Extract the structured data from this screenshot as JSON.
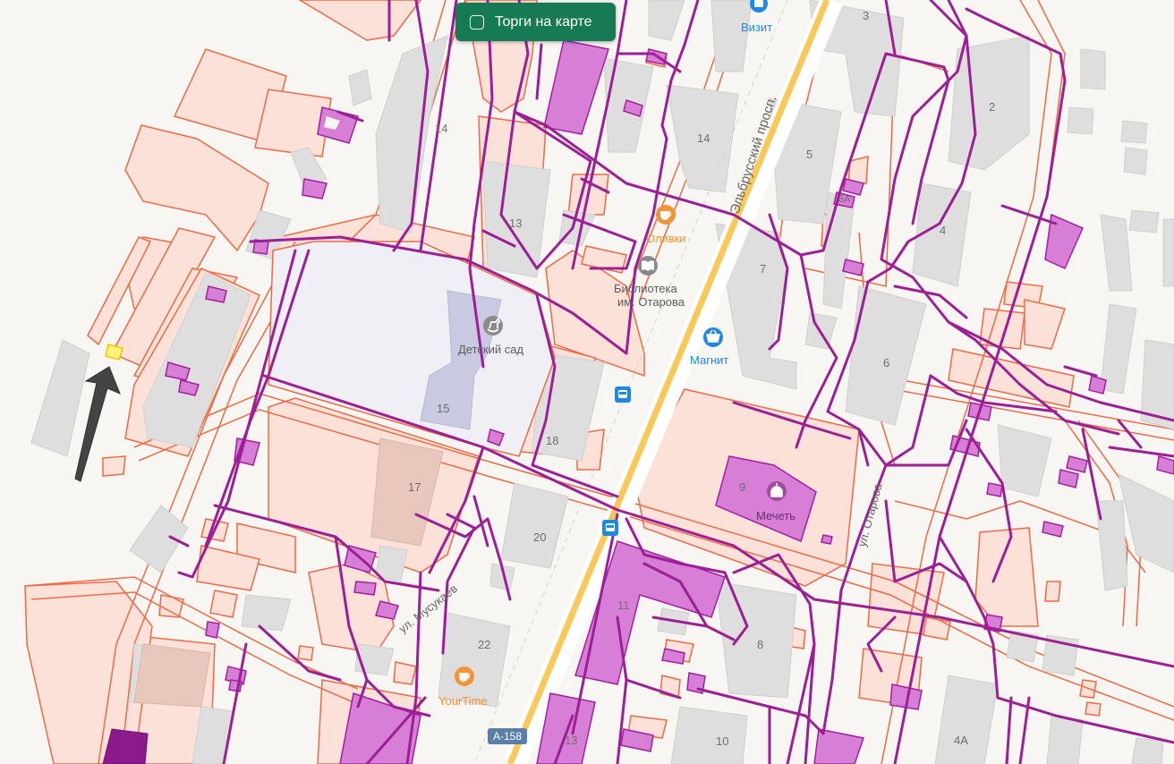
{
  "toggle": {
    "label": "Торги на карте",
    "checked": false
  },
  "pois": {
    "vizit": "Визит",
    "olivki": "Оливки",
    "library_line1": "Библиотека",
    "library_line2": "им. Отарова",
    "kindergarten": "Детский сад",
    "magnit": "Магнит",
    "mosque": "Мечеть",
    "yourtime": "YourTime"
  },
  "streets": {
    "elbrus": "Эльбрусский просп.",
    "otarova": "ул. Отарова",
    "musukaev": "ул. Мусукаев"
  },
  "road_badge": "А-158",
  "house_numbers": {
    "h3": "3",
    "h2": "2",
    "h14a": "14",
    "h14b": "14",
    "h5": "5",
    "h5a": "5А",
    "h4": "4",
    "h13": "13",
    "h7": "7",
    "h6": "6",
    "h15": "15",
    "h18": "18",
    "h9": "9",
    "h17": "17",
    "h20": "20",
    "h11": "11",
    "h8": "8",
    "h22": "22",
    "h13b": "13",
    "h10": "10",
    "h4a": "4А"
  },
  "colors": {
    "parcel_fill": "#fbe1d8",
    "parcel_stroke": "#ee6a45",
    "building": "#dedede",
    "magenta": "#9d1f95",
    "highlight": "#fff37a",
    "main_road": "#f8c95a"
  },
  "icons": {
    "shop": "shopping-bag-icon",
    "cafe": "cafe-cup-icon",
    "library": "book-icon",
    "kindergarten": "rocking-horse-icon",
    "market": "basket-icon",
    "mosque": "mosque-icon",
    "bus": "bus-stop-icon",
    "arrow": "pointer-arrow-icon"
  }
}
